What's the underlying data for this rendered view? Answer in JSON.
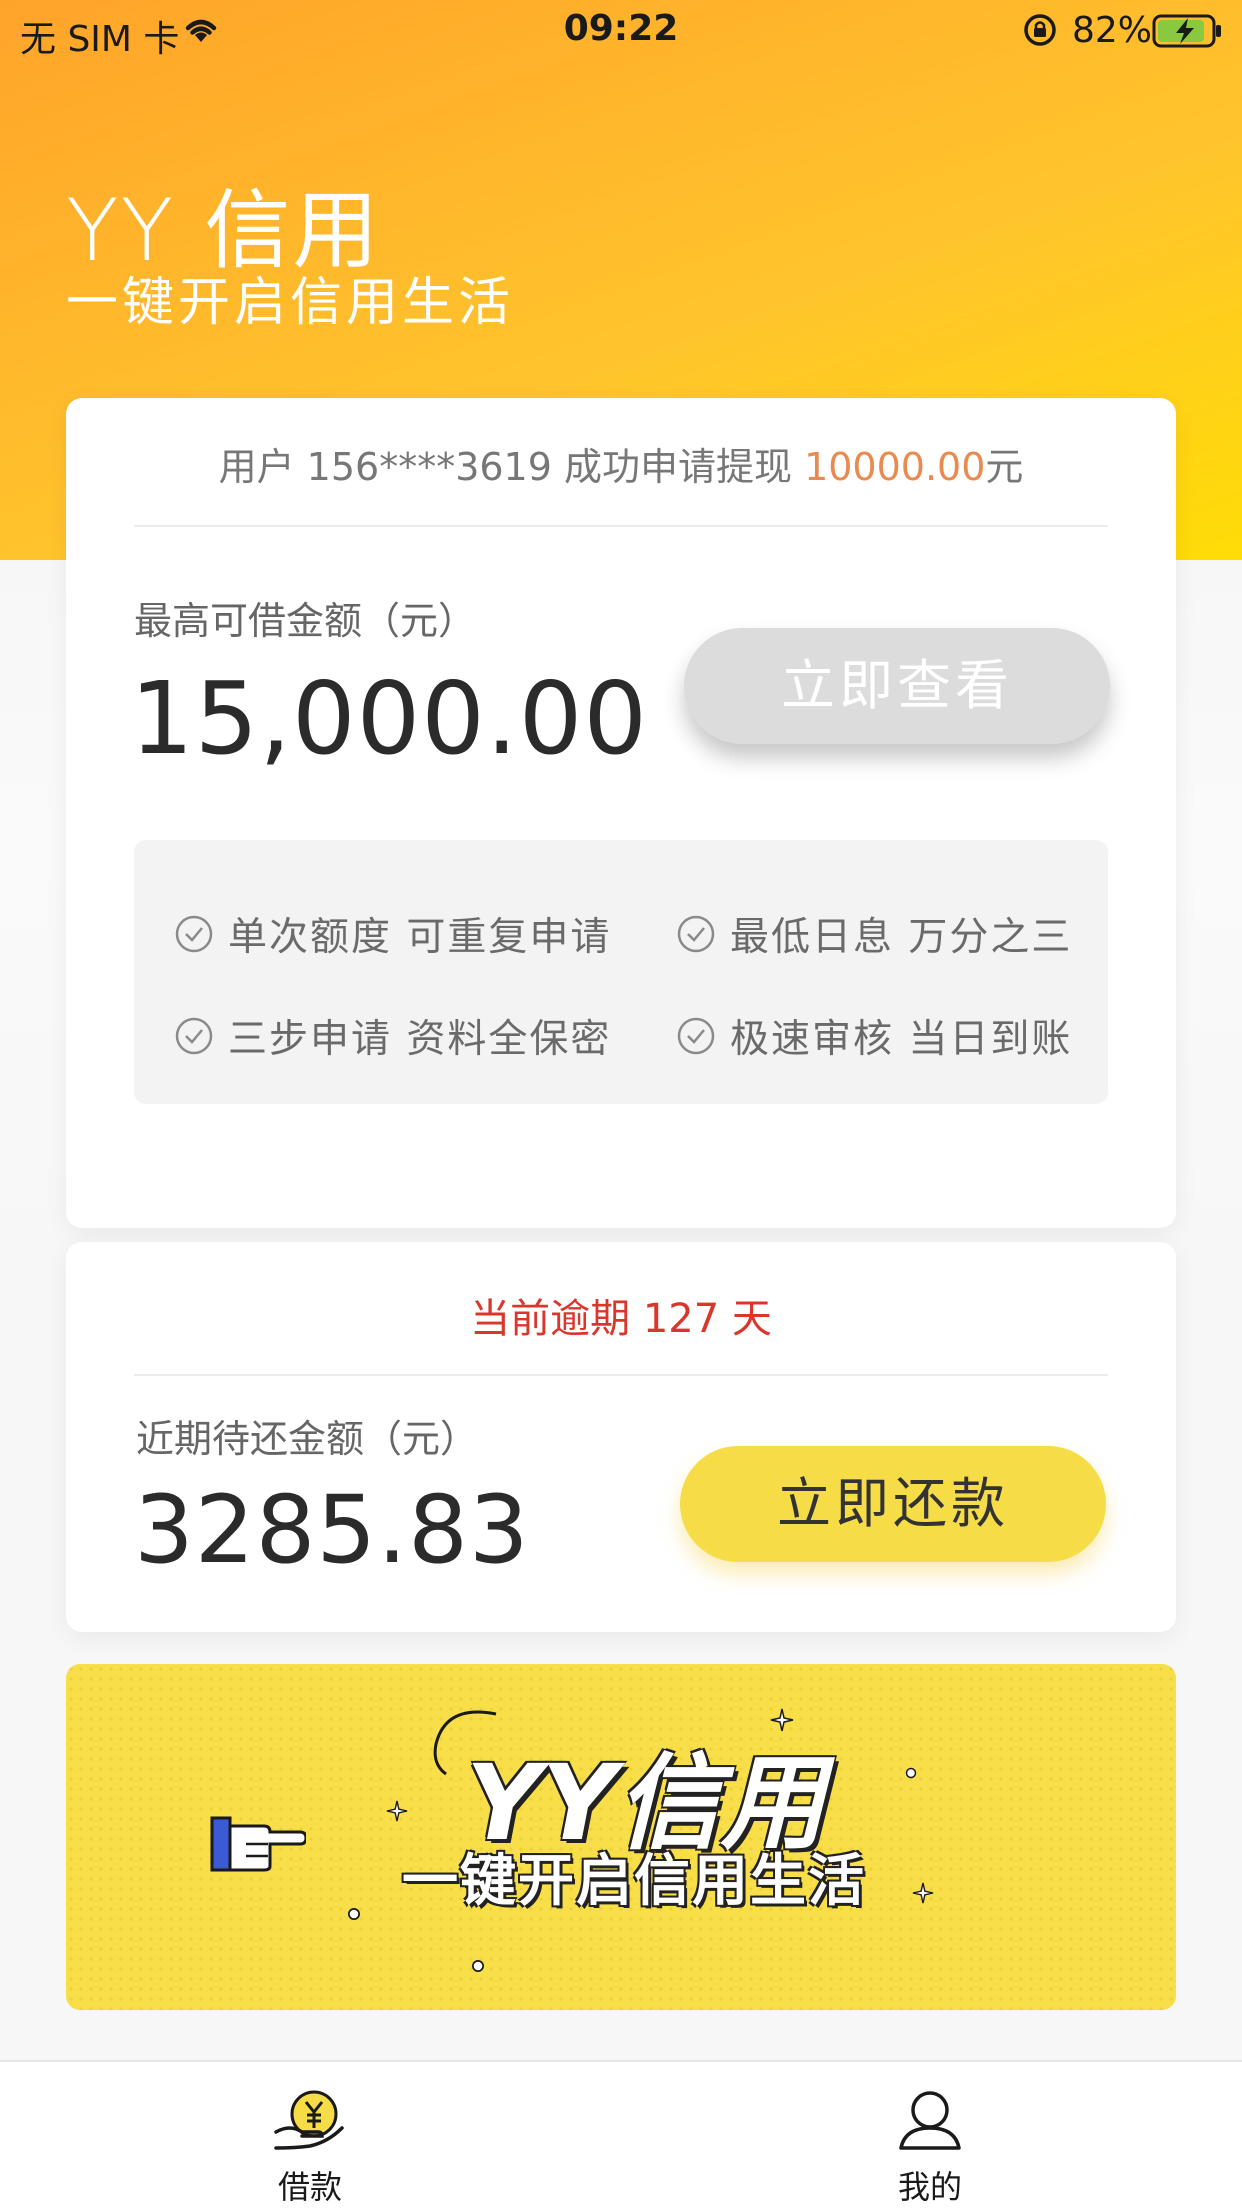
{
  "status_bar": {
    "carrier": "无 SIM 卡",
    "time": "09:22",
    "battery_percent": "82%"
  },
  "header": {
    "title": "YY 信用",
    "subtitle": "一键开启信用生活"
  },
  "loan_card": {
    "notice_prefix": "用户 156****3619 成功申请提现 ",
    "notice_amount": "10000.00",
    "notice_suffix": "元",
    "max_label": "最高可借金额（元）",
    "max_amount": "15,000.00",
    "view_button": "立即查看",
    "features": [
      "单次额度 可重复申请",
      "最低日息 万分之三",
      "三步申请 资料全保密",
      "极速审核 当日到账"
    ]
  },
  "repay_card": {
    "overdue_text": "当前逾期 127 天",
    "due_label": "近期待还金额（元）",
    "due_amount": "3285.83",
    "pay_button": "立即还款"
  },
  "banner": {
    "title": "YY信用",
    "subtitle": "一键开启信用生活"
  },
  "tabbar": {
    "tabs": [
      {
        "label": "借款",
        "icon": "loan-coin-icon"
      },
      {
        "label": "我的",
        "icon": "person-icon"
      }
    ]
  },
  "colors": {
    "hero_start": "#ffa42a",
    "hero_end": "#ffe000",
    "notice_amount": "#e98a50",
    "overdue": "#d9372c",
    "pay_button": "#f6dd48",
    "view_button": "#dcdcdc"
  }
}
